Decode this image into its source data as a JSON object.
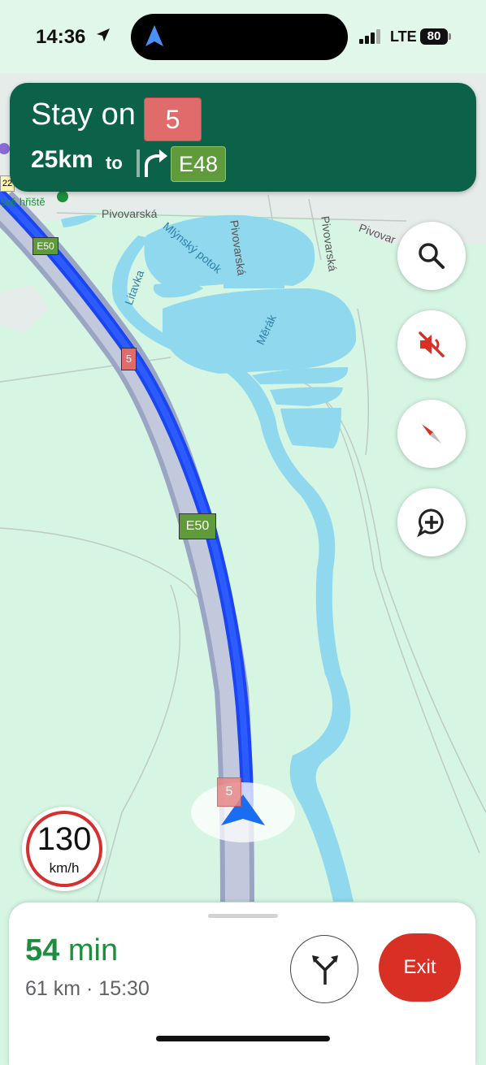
{
  "status_bar": {
    "time": "14:36",
    "network": "LTE",
    "battery": "80"
  },
  "guidance": {
    "instruction": "Stay on",
    "road_shield": "5",
    "distance": "25km",
    "distance_to": "to",
    "next_road_shield": "E48"
  },
  "map": {
    "labels": {
      "pivovarska_1": "Pivovarská",
      "pivovarska_2": "Pivovarská",
      "pivovarska_3": "Pivovarská",
      "pivovarska_4": "Pivovar",
      "mlynsky_potok": "Mlýnský potok",
      "litavka": "Litavka",
      "merak": "Měrák",
      "playground": "ské hřiště"
    },
    "shields": {
      "e50_top": "E50",
      "r5_top": "5",
      "e50_mid": "E50",
      "r5_bottom": "5",
      "road_22": "22"
    },
    "colors": {
      "route": "#1a45f0",
      "water": "#8fd8ee",
      "land": "#d6f5e3"
    }
  },
  "buttons": {
    "search_icon": "search-icon",
    "mute_icon": "volume-off-icon",
    "compass_icon": "compass-icon",
    "report_icon": "add-comment-icon"
  },
  "speed_limit": {
    "value": "130",
    "unit": "km/h"
  },
  "trip": {
    "minutes": "54",
    "min_label": "min",
    "details": "61 km · 15:30",
    "exit_label": "Exit",
    "alt_routes_icon": "alternate-routes-icon"
  }
}
